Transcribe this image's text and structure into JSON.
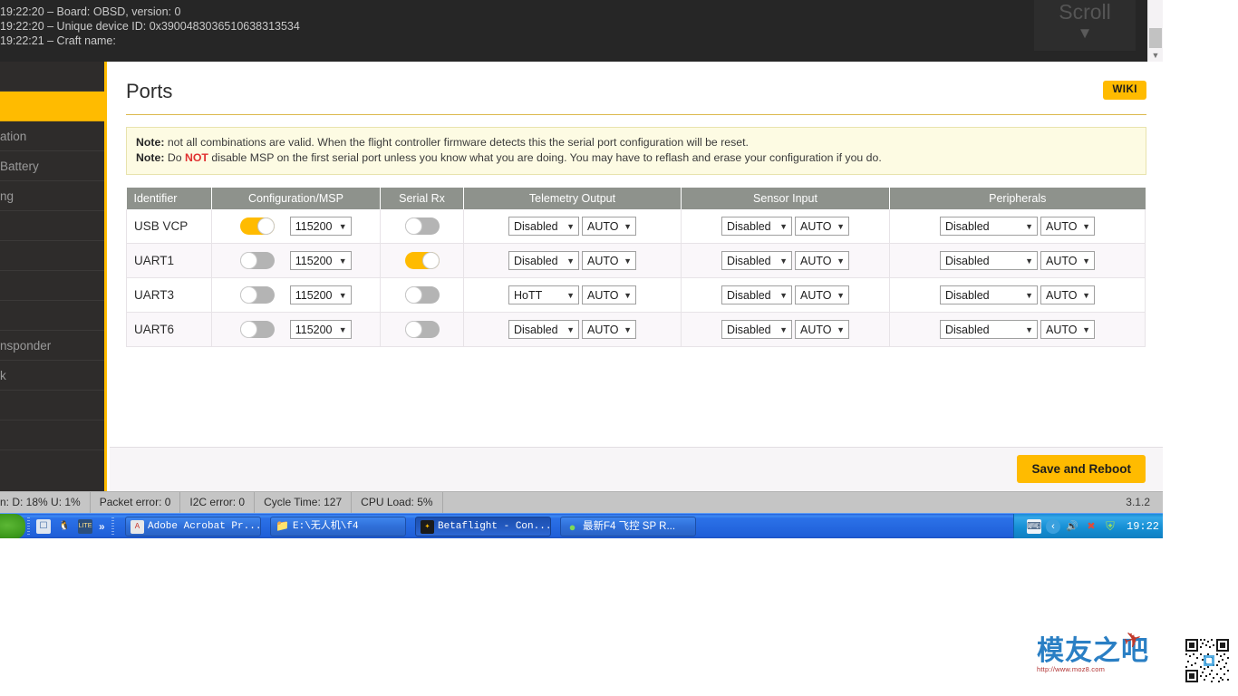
{
  "log": {
    "lines": [
      {
        "time": "19:22:20",
        "dash": "–",
        "text": "Board: ",
        "bold": "OBSD",
        "tail": ", version: ",
        "bold2": "0"
      },
      {
        "time": "19:22:20",
        "dash": "–",
        "text": "Unique device ID: ",
        "bold": "0x3900483036510638313534",
        "tail": "",
        "bold2": ""
      },
      {
        "time": "19:22:21",
        "dash": "–",
        "text": "Craft name:",
        "bold": "",
        "tail": "",
        "bold2": ""
      }
    ],
    "line1_full": "19:22:20 – Board: OBSD, version: 0",
    "line2_full": "19:22:20 – Unique device ID: 0x3900483036510638313534",
    "line3_full": "19:22:21 – Craft name:",
    "scroll_label": "Scroll",
    "scroll_chevron": "⌄"
  },
  "sidebar": {
    "items": [
      {
        "label": "",
        "active": false
      },
      {
        "label": "",
        "active": true
      },
      {
        "label": "ation",
        "active": false
      },
      {
        "label": " Battery",
        "active": false
      },
      {
        "label": "ng",
        "active": false
      },
      {
        "label": "",
        "active": false
      },
      {
        "label": "",
        "active": false
      },
      {
        "label": "",
        "active": false
      },
      {
        "label": "",
        "active": false
      },
      {
        "label": "nsponder",
        "active": false
      },
      {
        "label": "k",
        "active": false
      },
      {
        "label": "",
        "active": false
      },
      {
        "label": "",
        "active": false
      }
    ]
  },
  "header": {
    "title": "Ports",
    "wiki_label": "WIKI"
  },
  "notes": {
    "label": "Note:",
    "line1": " not all combinations are valid. When the flight controller firmware detects this the serial port configuration will be reset.",
    "line2_a": " Do ",
    "line2_not": "NOT",
    "line2_b": " disable MSP on the first serial port unless you know what you are doing. You may have to reflash and erase your configuration if you do."
  },
  "table": {
    "columns": [
      "Identifier",
      "Configuration/MSP",
      "Serial Rx",
      "Telemetry Output",
      "Sensor Input",
      "Peripherals"
    ],
    "rows": [
      {
        "identifier": "USB VCP",
        "msp_toggle": "on",
        "baud": "115200",
        "serial_rx_toggle": "off",
        "telemetry_fn": "Disabled",
        "telemetry_baud": "AUTO",
        "sensor_fn": "Disabled",
        "sensor_baud": "AUTO",
        "periph_fn": "Disabled",
        "periph_baud": "AUTO"
      },
      {
        "identifier": "UART1",
        "msp_toggle": "off",
        "baud": "115200",
        "serial_rx_toggle": "on",
        "telemetry_fn": "Disabled",
        "telemetry_baud": "AUTO",
        "sensor_fn": "Disabled",
        "sensor_baud": "AUTO",
        "periph_fn": "Disabled",
        "periph_baud": "AUTO"
      },
      {
        "identifier": "UART3",
        "msp_toggle": "off",
        "baud": "115200",
        "serial_rx_toggle": "off",
        "telemetry_fn": "HoTT",
        "telemetry_baud": "AUTO",
        "sensor_fn": "Disabled",
        "sensor_baud": "AUTO",
        "periph_fn": "Disabled",
        "periph_baud": "AUTO"
      },
      {
        "identifier": "UART6",
        "msp_toggle": "off",
        "baud": "115200",
        "serial_rx_toggle": "off",
        "telemetry_fn": "Disabled",
        "telemetry_baud": "AUTO",
        "sensor_fn": "Disabled",
        "sensor_baud": "AUTO",
        "periph_fn": "Disabled",
        "periph_baud": "AUTO"
      }
    ]
  },
  "footer": {
    "save_label": "Save and Reboot"
  },
  "status": {
    "throughput": "n: D: 18% U: 1%",
    "packet_error": "Packet error: 0",
    "i2c_error": "I2C error: 0",
    "cycle_time": "Cycle Time: 127",
    "cpu_load": "CPU Load: 5%",
    "version": "3.1.2"
  },
  "taskbar": {
    "quick_more": "»",
    "tasks": [
      {
        "label": "Adobe Acrobat Pr...",
        "icon": "acrobat-icon",
        "active": false
      },
      {
        "label": "E:\\无人机\\f4",
        "icon": "folder-icon",
        "active": false
      },
      {
        "label": "Betaflight - Con...",
        "icon": "betaflight-icon",
        "active": true
      },
      {
        "label": "最新F4 飞控 SP R...",
        "icon": "browser-icon",
        "active": false
      }
    ],
    "tray": {
      "keyboard": "⌨",
      "chevron": "‹",
      "speaker": "🔊",
      "network": "✖",
      "shield": "⛨",
      "clock": "19:22"
    }
  },
  "watermark": {
    "brand": "模友之吧",
    "url": "http://www.moz8.com",
    "plane_icon": "airplane-icon"
  },
  "colors": {
    "accent": "#ffbb00",
    "header_gray": "#8e928c",
    "note_bg": "#fdfbe3",
    "danger": "#e03131",
    "sidebar_bg": "#2e2c2b",
    "log_bg": "#262626"
  }
}
